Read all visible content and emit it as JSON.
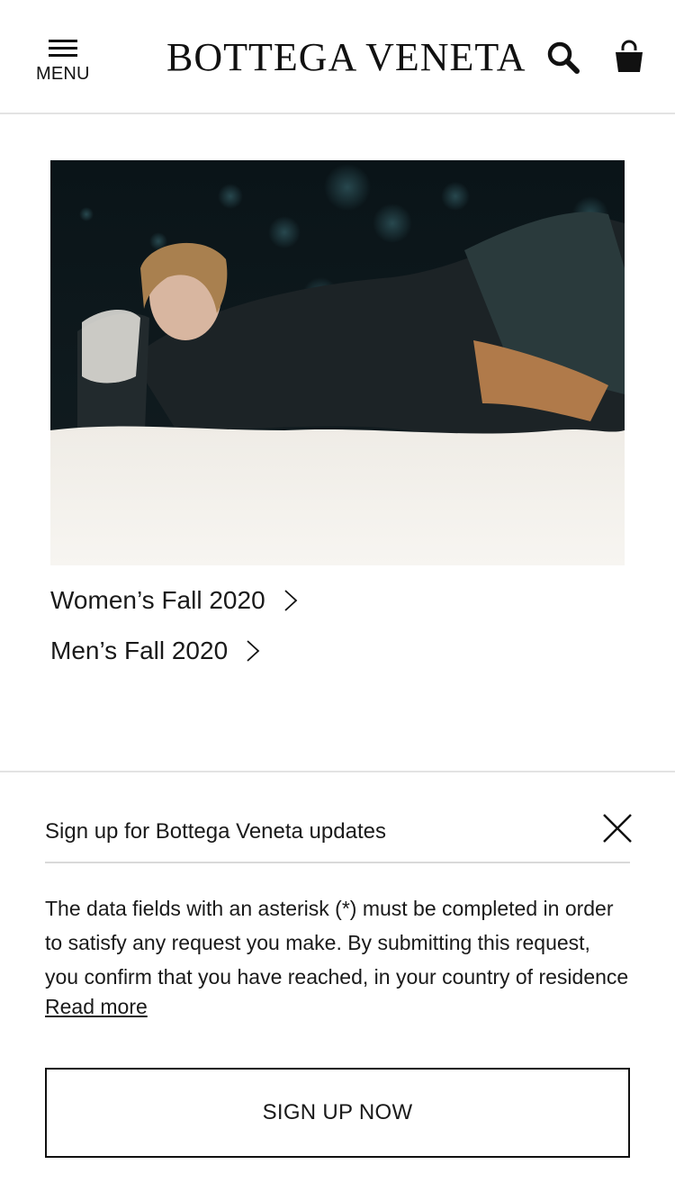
{
  "header": {
    "menu_label": "MENU",
    "logo_text": "BOTTEGA VENETA",
    "search_icon": "search-icon",
    "bag_icon": "shopping-bag-icon"
  },
  "hero": {
    "icon": "fall-2020-campaign-photo"
  },
  "collections": [
    {
      "label": "Women’s Fall 2020",
      "icon": "chevron-right-icon"
    },
    {
      "label": "Men’s Fall 2020",
      "icon": "chevron-right-icon"
    }
  ],
  "signup": {
    "title": "Sign up for Bottega Veneta updates",
    "close_icon": "close-icon",
    "body_lines": [
      "The data fields with an asterisk (*) must be completed in order",
      "to satisfy any request you make. By submitting this request,",
      "you confirm that you have reached, in your country of residence"
    ],
    "read_more": "Read more",
    "cta_label": "SIGN UP NOW"
  },
  "colors": {
    "text": "#1a1a1a",
    "divider": "#e3e3e3",
    "background": "#ffffff"
  }
}
